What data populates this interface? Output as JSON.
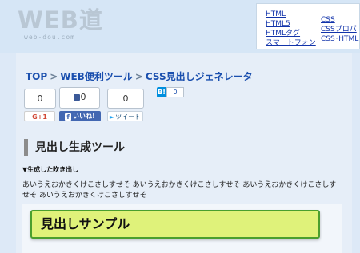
{
  "header": {
    "logo_text": "WEB道",
    "logo_sub": "web-dou.com",
    "menu_col1": [
      "HTML",
      "HTML5",
      "HTMLタグ",
      "スマートフォン"
    ],
    "menu_col2": [
      "CSS",
      "CSSプロパ",
      "CSS･HTML"
    ]
  },
  "breadcrumb": {
    "items": [
      "TOP",
      "WEB便利ツール",
      "CSS見出しジェネレータ"
    ],
    "separator": ">"
  },
  "social": {
    "count1": "0",
    "count2": "0",
    "count3": "0",
    "hatena_label": "B!",
    "hatena_count": "0",
    "gplus_label": "G+1",
    "fb_label": "いいね!",
    "fb_icon": "f",
    "tweet_label": "ツイート"
  },
  "section": {
    "title": "見出し生成ツール",
    "sub_label": "▼生成した吹き出し",
    "sample_text": "あいうえおかきくけこさしすせそ あいうえおかきくけこさしすせそ あいうえおかきくけこさしすせそ あいうえおかきくけこさしすせそ",
    "heading_sample": "見出しサンプル"
  },
  "colors": {
    "link": "#1a4fae",
    "heading_bg": "#dff27a",
    "heading_border": "#4a9f2e",
    "facebook": "#4267b2",
    "hatena": "#008fde"
  }
}
